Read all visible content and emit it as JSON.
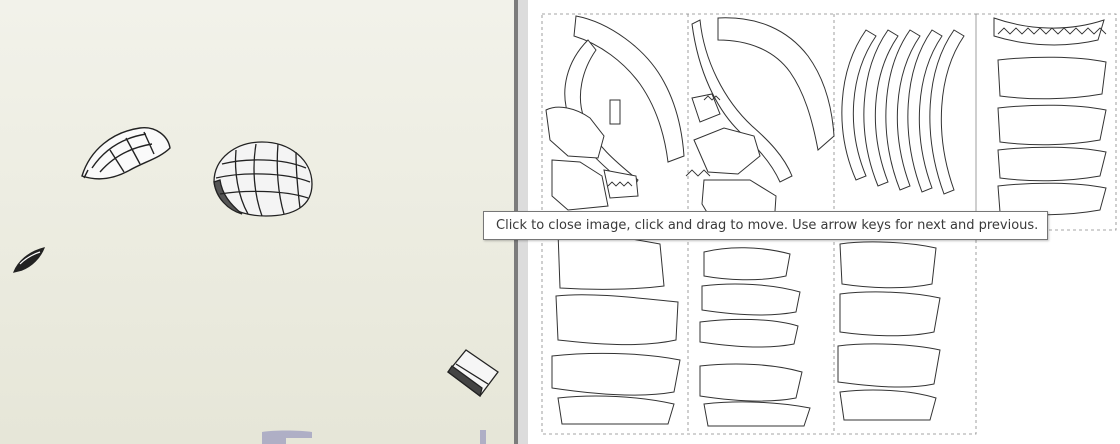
{
  "tooltip": {
    "text": "Click to close image, click and drag to move. Use arrow keys for next and previous."
  },
  "colors": {
    "viewport_bg": "#ebebdf",
    "divider": "#7c7c7c",
    "paper": "#ffffff",
    "line": "#333333",
    "tooltip_border": "#767676",
    "watermark": "#9a9ab8"
  },
  "viewport": {
    "objects": [
      "helmet-shell-part",
      "dome-part",
      "small-fin-part",
      "box-part"
    ]
  },
  "image_panel": {
    "sheets": [
      "papercraft-template-sheet"
    ]
  }
}
